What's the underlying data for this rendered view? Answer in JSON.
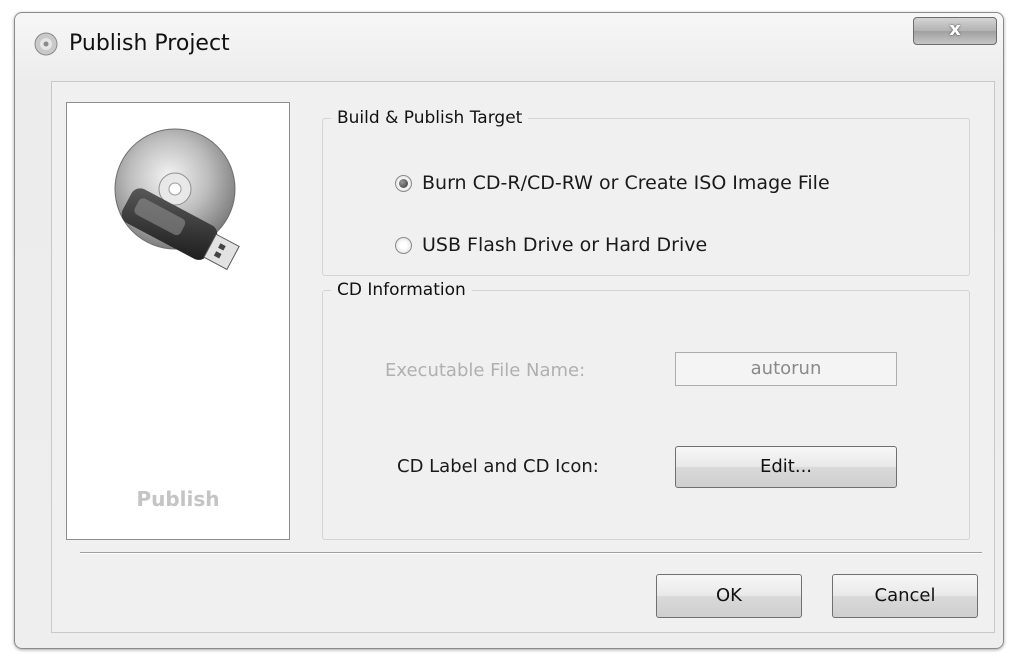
{
  "window": {
    "title": "Publish Project",
    "close_label": "x"
  },
  "side_panel": {
    "caption": "Publish"
  },
  "build_target": {
    "legend": "Build & Publish Target",
    "options": [
      {
        "label": "Burn CD-R/CD-RW or Create ISO Image File",
        "checked": true
      },
      {
        "label": "USB Flash Drive or Hard Drive",
        "checked": false
      }
    ]
  },
  "cd_info": {
    "legend": "CD Information",
    "exe_label": "Executable File Name:",
    "exe_value": "autorun",
    "label_icon_label": "CD Label and CD Icon:",
    "edit_label": "Edit..."
  },
  "footer": {
    "ok_label": "OK",
    "cancel_label": "Cancel"
  }
}
